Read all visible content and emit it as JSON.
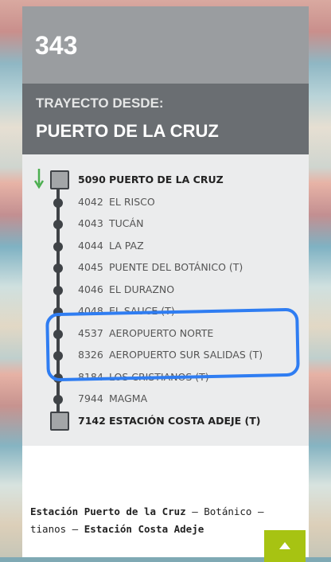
{
  "route": {
    "number": "343"
  },
  "origin": {
    "label": "TRAYECTO DESDE:",
    "name": "PUERTO DE LA CRUZ"
  },
  "stops": [
    {
      "code": "5090",
      "name": "PUERTO DE LA CRUZ",
      "terminal": true
    },
    {
      "code": "4042",
      "name": "EL RISCO",
      "terminal": false
    },
    {
      "code": "4043",
      "name": "TUCÁN",
      "terminal": false
    },
    {
      "code": "4044",
      "name": "LA PAZ",
      "terminal": false
    },
    {
      "code": "4045",
      "name": "PUENTE DEL BOTÁNICO (T)",
      "terminal": false
    },
    {
      "code": "4046",
      "name": "EL DURAZNO",
      "terminal": false
    },
    {
      "code": "4048",
      "name": "EL SAUCE (T)",
      "terminal": false
    },
    {
      "code": "4537",
      "name": "AEROPUERTO NORTE",
      "terminal": false
    },
    {
      "code": "8326",
      "name": "AEROPUERTO SUR SALIDAS (T)",
      "terminal": false
    },
    {
      "code": "8184",
      "name": "LOS CRISTIANOS (T)",
      "terminal": false
    },
    {
      "code": "7944",
      "name": "MAGMA",
      "terminal": false
    },
    {
      "code": "7142",
      "name": "ESTACIÓN COSTA ADEJE (T)",
      "terminal": true
    }
  ],
  "route_summary": {
    "part1": "Estación Puerto de la Cruz",
    "sep1": " – Botánico – ",
    "part2": "tianos – ",
    "part3": "Estación Costa Adeje"
  },
  "colors": {
    "accent": "#a7c312",
    "annotation": "#2f7df2",
    "arrow": "#4caf50"
  },
  "icons": {
    "scroll_top": "chevron-up-icon",
    "direction": "arrow-down-icon"
  }
}
